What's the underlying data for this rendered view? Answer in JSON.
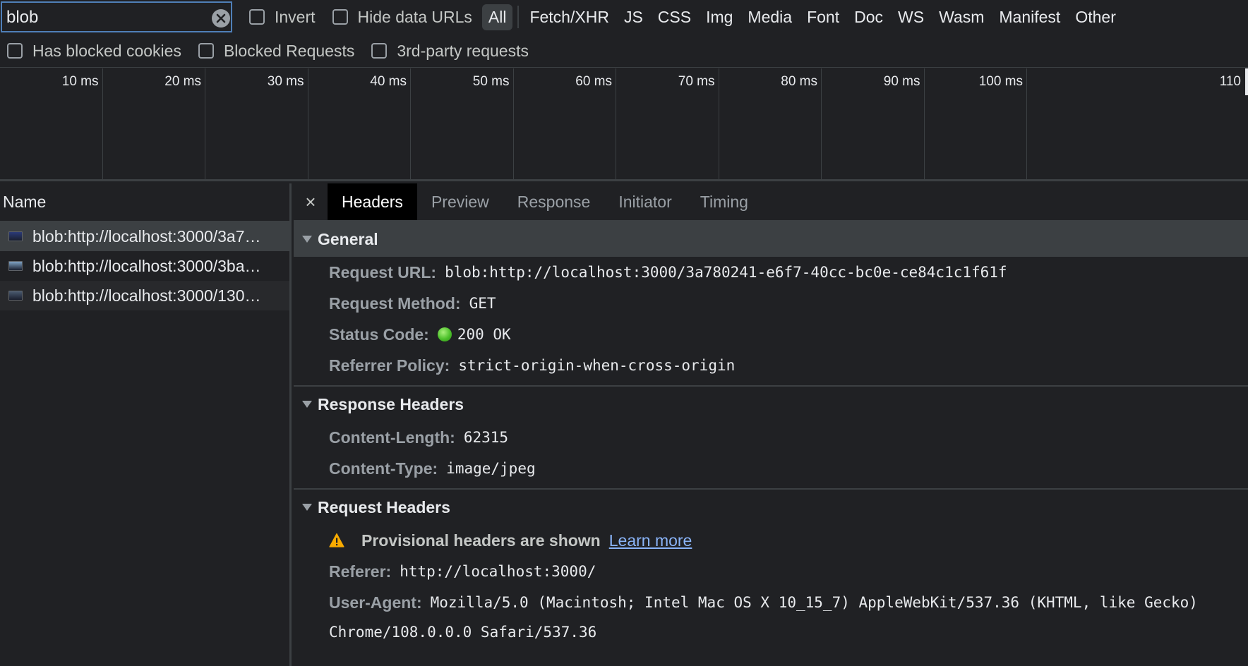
{
  "filter": {
    "search_value": "blob",
    "invert_label": "Invert",
    "hide_data_urls_label": "Hide data URLs",
    "types": [
      "All",
      "Fetch/XHR",
      "JS",
      "CSS",
      "Img",
      "Media",
      "Font",
      "Doc",
      "WS",
      "Wasm",
      "Manifest",
      "Other"
    ],
    "active_type": "All",
    "has_blocked_cookies_label": "Has blocked cookies",
    "blocked_requests_label": "Blocked Requests",
    "third_party_label": "3rd-party requests"
  },
  "timeline": {
    "ticks": [
      "10 ms",
      "20 ms",
      "30 ms",
      "40 ms",
      "50 ms",
      "60 ms",
      "70 ms",
      "80 ms",
      "90 ms",
      "100 ms",
      "110"
    ]
  },
  "requests": {
    "column_header": "Name",
    "rows": [
      {
        "name": "blob:http://localhost:3000/3a780241-e6f7-40cc-bc0e-ce84c1c1f61f",
        "display": "blob:http://localhost:3000/3a7…",
        "thumb": "#2b3a78"
      },
      {
        "name": "blob:http://localhost:3000/3ba",
        "display": "blob:http://localhost:3000/3ba…",
        "thumb": "#7fa2c4"
      },
      {
        "name": "blob:http://localhost:3000/130",
        "display": "blob:http://localhost:3000/130…",
        "thumb": "#4a5a70"
      }
    ]
  },
  "details": {
    "close_label": "×",
    "tabs": [
      "Headers",
      "Preview",
      "Response",
      "Initiator",
      "Timing"
    ],
    "active_tab": "Headers",
    "general": {
      "title": "General",
      "request_url_key": "Request URL:",
      "request_url": "blob:http://localhost:3000/3a780241-e6f7-40cc-bc0e-ce84c1c1f61f",
      "request_method_key": "Request Method:",
      "request_method": "GET",
      "status_code_key": "Status Code:",
      "status_code": "200 OK",
      "referrer_policy_key": "Referrer Policy:",
      "referrer_policy": "strict-origin-when-cross-origin"
    },
    "response_headers": {
      "title": "Response Headers",
      "content_length_key": "Content-Length:",
      "content_length": "62315",
      "content_type_key": "Content-Type:",
      "content_type": "image/jpeg"
    },
    "request_headers": {
      "title": "Request Headers",
      "provisional_warning": "Provisional headers are shown",
      "learn_more": "Learn more",
      "referer_key": "Referer:",
      "referer": "http://localhost:3000/",
      "user_agent_key": "User-Agent:",
      "user_agent_line1": "Mozilla/5.0 (Macintosh; Intel Mac OS X 10_15_7) AppleWebKit/537.36 (KHTML, like Gecko)",
      "user_agent_line2": "Chrome/108.0.0.0 Safari/537.36"
    }
  },
  "colors": {
    "status_ok": "#4cc02a",
    "warning": "#f9ab00",
    "link": "#8ab4f8"
  }
}
